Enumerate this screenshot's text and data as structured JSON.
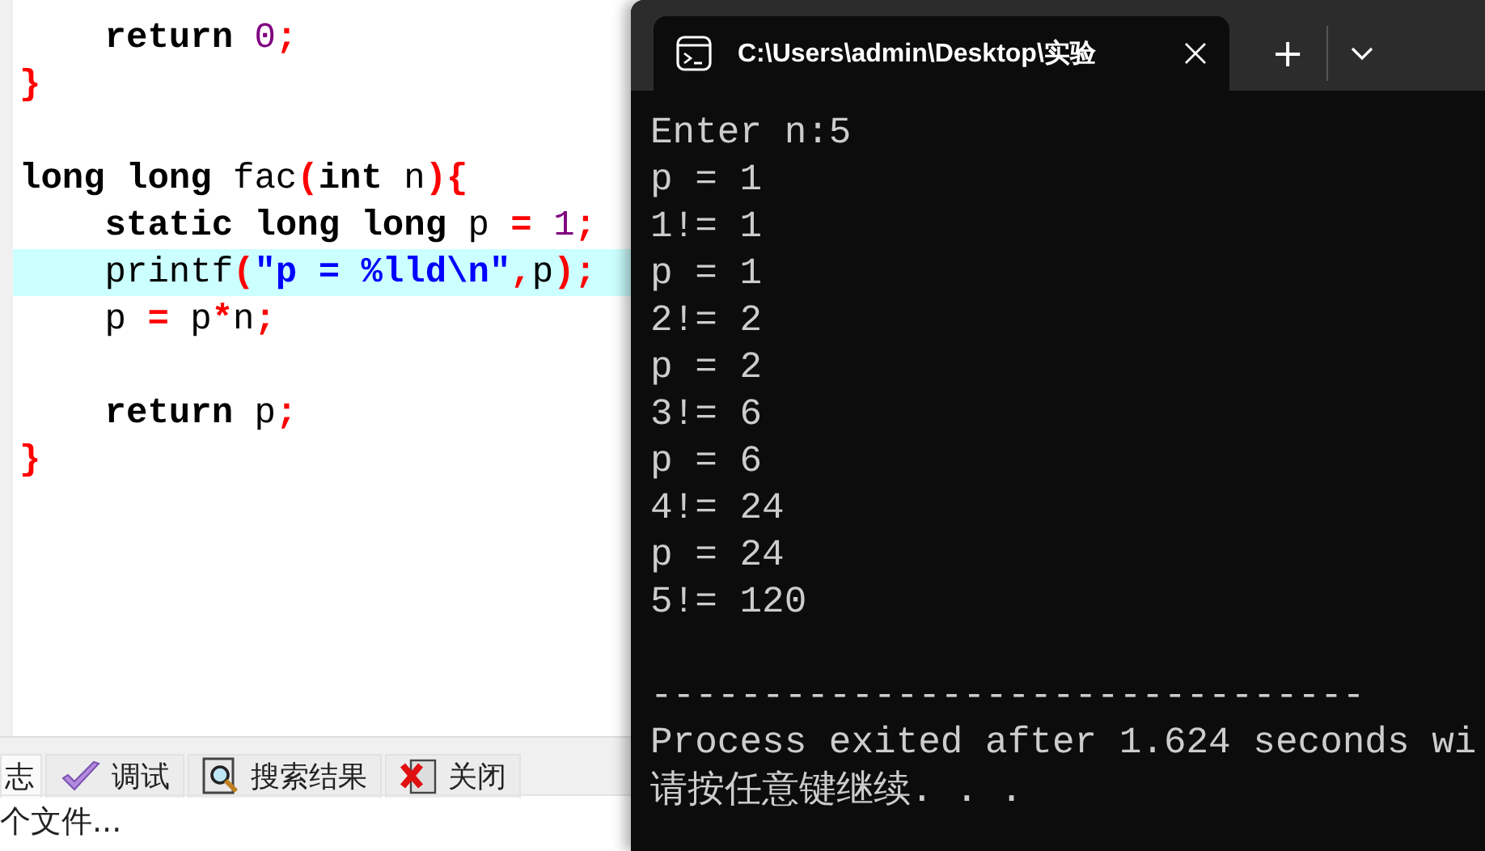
{
  "editor": {
    "lines": [
      {
        "highlighted": false,
        "tokens": [
          {
            "text": "    return ",
            "kind": "keyword"
          },
          {
            "text": "0",
            "kind": "number"
          },
          {
            "text": ";",
            "kind": "punct"
          }
        ]
      },
      {
        "highlighted": false,
        "tokens": [
          {
            "text": "}",
            "kind": "punct"
          }
        ]
      },
      {
        "highlighted": false
      },
      {
        "highlighted": false,
        "tokens": [
          {
            "text": "long long ",
            "kind": "keyword"
          },
          {
            "text": "fac",
            "kind": "plain"
          },
          {
            "text": "(",
            "kind": "punct"
          },
          {
            "text": "int ",
            "kind": "keyword"
          },
          {
            "text": "n",
            "kind": "plain"
          },
          {
            "text": "){",
            "kind": "punct"
          }
        ]
      },
      {
        "highlighted": false,
        "tokens": [
          {
            "text": "    static long long ",
            "kind": "keyword"
          },
          {
            "text": "p ",
            "kind": "plain"
          },
          {
            "text": "= ",
            "kind": "punct"
          },
          {
            "text": "1",
            "kind": "number"
          },
          {
            "text": ";",
            "kind": "punct"
          }
        ]
      },
      {
        "highlighted": true,
        "tokens": [
          {
            "text": "    printf",
            "kind": "plain"
          },
          {
            "text": "(",
            "kind": "punct"
          },
          {
            "text": "\"p = %lld\\n\"",
            "kind": "string"
          },
          {
            "text": ",",
            "kind": "punct"
          },
          {
            "text": "p",
            "kind": "plain"
          },
          {
            "text": ");",
            "kind": "punct"
          }
        ]
      },
      {
        "highlighted": false,
        "tokens": [
          {
            "text": "    p ",
            "kind": "plain"
          },
          {
            "text": "= ",
            "kind": "punct"
          },
          {
            "text": "p",
            "kind": "plain"
          },
          {
            "text": "*",
            "kind": "punct"
          },
          {
            "text": "n",
            "kind": "plain"
          },
          {
            "text": ";",
            "kind": "punct"
          }
        ]
      },
      {
        "highlighted": false
      },
      {
        "highlighted": false,
        "tokens": [
          {
            "text": "    return ",
            "kind": "keyword"
          },
          {
            "text": "p",
            "kind": "plain"
          },
          {
            "text": ";",
            "kind": "punct"
          }
        ]
      },
      {
        "highlighted": false,
        "tokens": [
          {
            "text": "}",
            "kind": "punct"
          }
        ]
      }
    ]
  },
  "bottom_tabs": [
    {
      "label": "志",
      "kind": "plain",
      "selected": true
    },
    {
      "label": "调试",
      "kind": "check",
      "selected": false
    },
    {
      "label": "搜索结果",
      "kind": "search",
      "selected": false
    },
    {
      "label": "关闭",
      "kind": "close",
      "selected": false
    }
  ],
  "status_bar": "个文件...",
  "terminal": {
    "tab_title": "C:\\Users\\admin\\Desktop\\实验",
    "new_tab": "+",
    "output": [
      {
        "kind": "text",
        "text": "Enter n:5"
      },
      {
        "kind": "text",
        "text": "p = 1"
      },
      {
        "kind": "text",
        "text": "1!= 1"
      },
      {
        "kind": "text",
        "text": "p = 1"
      },
      {
        "kind": "text",
        "text": "2!= 2"
      },
      {
        "kind": "text",
        "text": "p = 2"
      },
      {
        "kind": "text",
        "text": "3!= 6"
      },
      {
        "kind": "text",
        "text": "p = 6"
      },
      {
        "kind": "text",
        "text": "4!= 24"
      },
      {
        "kind": "text",
        "text": "p = 24"
      },
      {
        "kind": "text",
        "text": "5!= 120"
      },
      {
        "kind": "blank"
      },
      {
        "kind": "text",
        "text": "--------------------------------"
      },
      {
        "kind": "text",
        "text": "Process exited after 1.624 seconds wi"
      },
      {
        "kind": "text",
        "text": "请按任意键继续. . ."
      }
    ]
  }
}
